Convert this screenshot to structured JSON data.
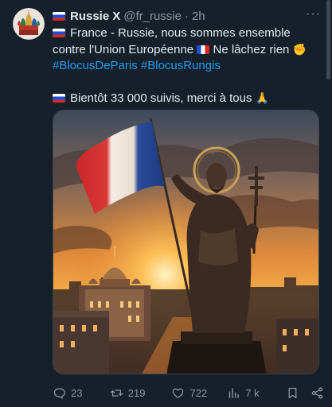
{
  "author": {
    "name": "Russie",
    "name_suffix": "X",
    "handle": "@fr_russie",
    "separator": "·",
    "time": "2h"
  },
  "menu": {
    "more_label": "···"
  },
  "tweet": {
    "line1_a": "France - Russie, nous sommes ensemble contre l'Union Européenne",
    "line1_b": "Ne lâchez rien",
    "fist_emoji": "✊",
    "hashtag1": "#BlocusDeParis",
    "hashtag2": "#BlocusRungis",
    "line3": "Bientôt 33 000 suivis, merci à tous",
    "pray_emoji": "🙏"
  },
  "actions": {
    "replies": "23",
    "reposts": "219",
    "likes": "722",
    "views": "7 k"
  },
  "colors": {
    "background": "#15202b",
    "text": "#e7e9ea",
    "secondary": "#8b98a5",
    "link": "#1d9bf0",
    "border": "#38444d"
  },
  "icons": {
    "reply": "reply-icon",
    "repost": "repost-icon",
    "like": "heart-icon",
    "views": "views-icon",
    "bookmark": "bookmark-icon",
    "share": "share-icon"
  }
}
